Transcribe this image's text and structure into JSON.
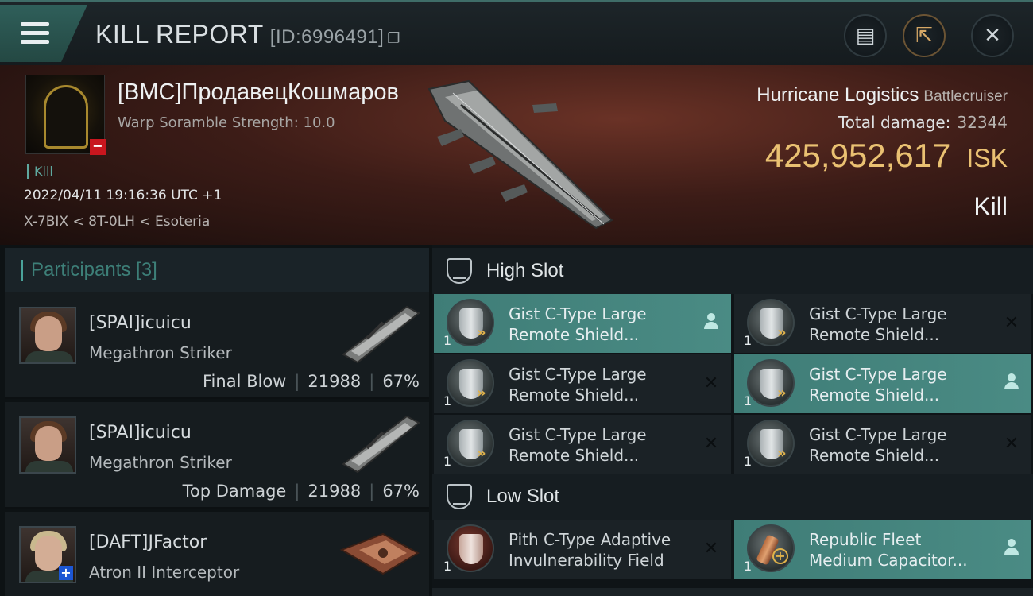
{
  "header": {
    "title": "KILL REPORT",
    "id_text": "[ID:6996491]"
  },
  "victim": {
    "name": "[BMC]ПродавецКошмаров",
    "scramble": "Warp Soramble Strength: 10.0",
    "tag": "Kill",
    "datetime": "2022/04/11 19:16:36 UTC +1",
    "location": "X-7BIX < 8T-0LH < Esoteria",
    "ship_name": "Hurricane Logistics",
    "ship_class": "Battlecruiser",
    "total_damage_label": "Total damage:",
    "total_damage": "32344",
    "isk_value": "425,952,617",
    "isk_label": "ISK",
    "result": "Kill"
  },
  "participants": {
    "label": "Participants [3]",
    "rows": [
      {
        "name": "[SPAI]icuicu",
        "ship": "Megathron Striker",
        "role": "Final Blow",
        "damage": "21988",
        "percent": "67%"
      },
      {
        "name": "[SPAI]icuicu",
        "ship": "Megathron Striker",
        "role": "Top Damage",
        "damage": "21988",
        "percent": "67%"
      },
      {
        "name": "[DAFT]JFactor",
        "ship": "Atron II Interceptor",
        "role": "",
        "damage": "",
        "percent": ""
      }
    ]
  },
  "slots": {
    "high_label": "High Slot",
    "low_label": "Low Slot",
    "high_items": [
      {
        "qty": "1",
        "line1": "Gist C-Type Large",
        "line2": "Remote Shield...",
        "state": "owned"
      },
      {
        "qty": "1",
        "line1": "Gist C-Type Large",
        "line2": "Remote Shield...",
        "state": "destroyed"
      },
      {
        "qty": "1",
        "line1": "Gist C-Type Large",
        "line2": "Remote Shield...",
        "state": "destroyed"
      },
      {
        "qty": "1",
        "line1": "Gist C-Type Large",
        "line2": "Remote Shield...",
        "state": "owned"
      },
      {
        "qty": "1",
        "line1": "Gist C-Type Large",
        "line2": "Remote Shield...",
        "state": "destroyed"
      },
      {
        "qty": "1",
        "line1": "Gist C-Type Large",
        "line2": "Remote Shield...",
        "state": "destroyed"
      }
    ],
    "low_items": [
      {
        "qty": "1",
        "line1": "Pith C-Type Adaptive",
        "line2": "Invulnerability Field",
        "state": "destroyed"
      },
      {
        "qty": "1",
        "line1": "Republic Fleet",
        "line2": "Medium Capacitor...",
        "state": "owned"
      }
    ]
  },
  "colors": {
    "accent_teal": "#4a8b84",
    "isk_gold": "#eac172",
    "danger_red": "#c8161e"
  }
}
